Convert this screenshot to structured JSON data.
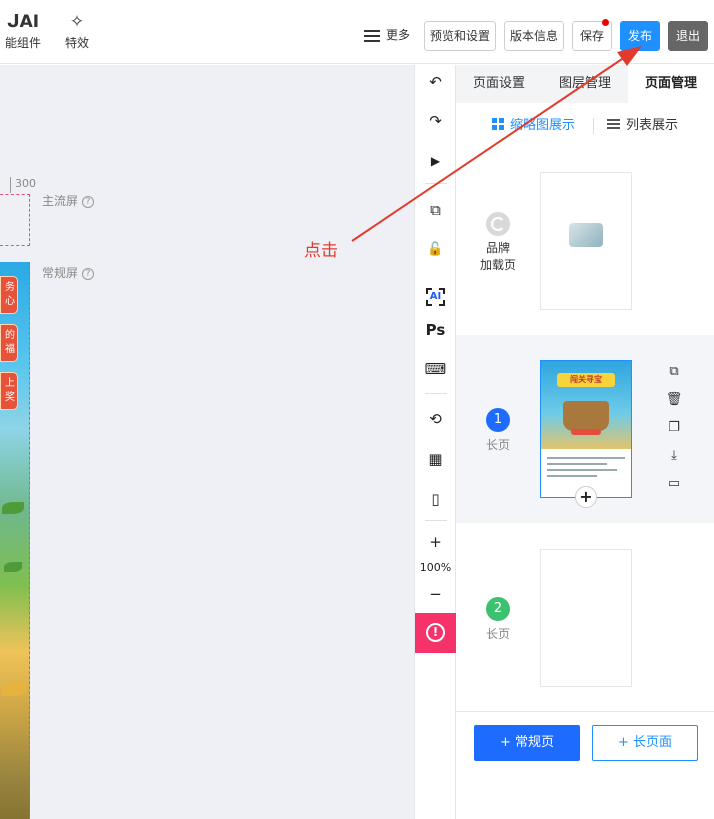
{
  "toolbar": {
    "ai_component": {
      "icon_label": "ᒍAI",
      "label": "能组件"
    },
    "effects": {
      "icon_label": "✧",
      "label": "特效"
    },
    "more_label": "更多",
    "preview_settings_label": "预览和设置",
    "version_info_label": "版本信息",
    "save_label": "保存",
    "publish_label": "发布",
    "exit_label": "退出"
  },
  "canvas": {
    "ruler_value": "300",
    "main_screen_label": "主流屏",
    "normal_screen_label": "常规屏",
    "help_glyph": "?",
    "strip_buttons": [
      "务\n心",
      "的\n福",
      "上\n奖"
    ]
  },
  "annotation": {
    "click_text": "点击",
    "color": "#e23a2c"
  },
  "vertical_tools": {
    "undo": "↶",
    "redo": "↷",
    "play": "▶",
    "copy": "⧉",
    "lock": "🔓",
    "ai": "AI",
    "ps": "Ps",
    "keyboard": "⌨",
    "rotate": "⟲",
    "grid": "▦",
    "device": "▯",
    "zoom_in": "+",
    "zoom_level": "100%",
    "zoom_out": "−",
    "warning": "!"
  },
  "right_panel": {
    "tabs": [
      "页面设置",
      "图层管理",
      "页面管理"
    ],
    "active_tab": 2,
    "view_thumbnail_label": "缩略图展示",
    "view_list_label": "列表展示",
    "pages": [
      {
        "number": "",
        "name": "品牌\n加载页"
      },
      {
        "number": "1",
        "name": "长页",
        "color": "#1e6cff"
      },
      {
        "number": "2",
        "name": "长页",
        "color": "#3cc26f"
      }
    ],
    "add_normal_page_label": "+ 常规页",
    "add_long_page_label": "+ 长页面",
    "thumb_caption": "闯关寻宝"
  },
  "colors": {
    "primary": "#1e90ff",
    "accent": "#1e6cff",
    "warning": "#f5336a"
  }
}
